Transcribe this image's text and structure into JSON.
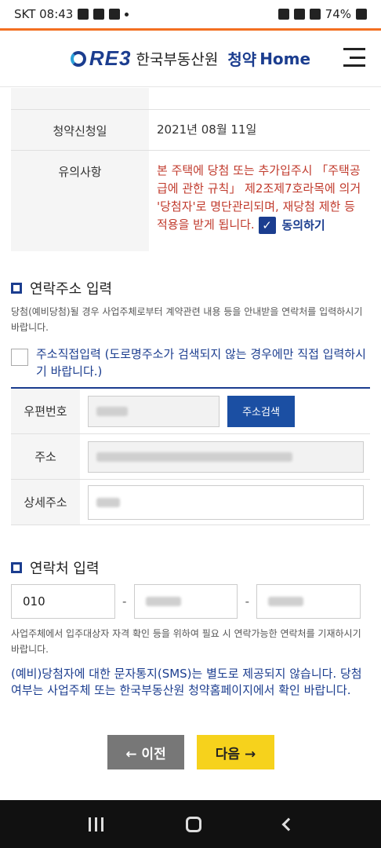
{
  "status_bar": {
    "carrier_time": "SKT 08:43",
    "battery": "74%"
  },
  "header": {
    "logo_reb": "RE3",
    "logo_org": "한국부동산원",
    "logo_cheong": "청약",
    "logo_home": "Home"
  },
  "info_table": {
    "rows": [
      {
        "label": "청약신청일",
        "value": "2021년 08월 11일"
      },
      {
        "label": "유의사항",
        "value": "본 주택에 당첨 또는 추가입주시 「주택공급에 관한 규칙」 제2조제7호라목에 의거 '당첨자'로 명단관리되며, 재당첨 제한 등 적용을 받게 됩니다."
      }
    ],
    "agree_label": "동의하기"
  },
  "address_section": {
    "title": "연락주소 입력",
    "desc": "당첨(예비당첨)될 경우 사업주체로부터 계약관련 내용 등을 안내받을 연락처를 입력하시기 바랍니다.",
    "direct_input_label": "주소직접입력 (도로명주소가 검색되지 않는 경우에만 직접 입력하시기 바랍니다.)",
    "rows": {
      "zip_label": "우편번호",
      "search_button": "주소검색",
      "addr_label": "주소",
      "detail_label": "상세주소"
    }
  },
  "phone_section": {
    "title": "연락처 입력",
    "prefix": "010",
    "dash": "-",
    "desc": "사업주체에서 입주대상자 자격 확인 등을 위하여 필요 시 연락가능한 연락처를 기재하시기 바랍니다."
  },
  "sms_note": "(예비)당첨자에 대한 문자통지(SMS)는 별도로 제공되지 않습니다. 당첨여부는 사업주체 또는 한국부동산원 청약홈페이지에서 확인 바랍니다.",
  "buttons": {
    "prev": "← 이전",
    "next": "다음 →"
  },
  "colors": {
    "accent": "#1b3d8f",
    "warning": "#c0392b",
    "next_button": "#f6d21c",
    "prev_button": "#777777",
    "top_line": "#f36f21"
  }
}
